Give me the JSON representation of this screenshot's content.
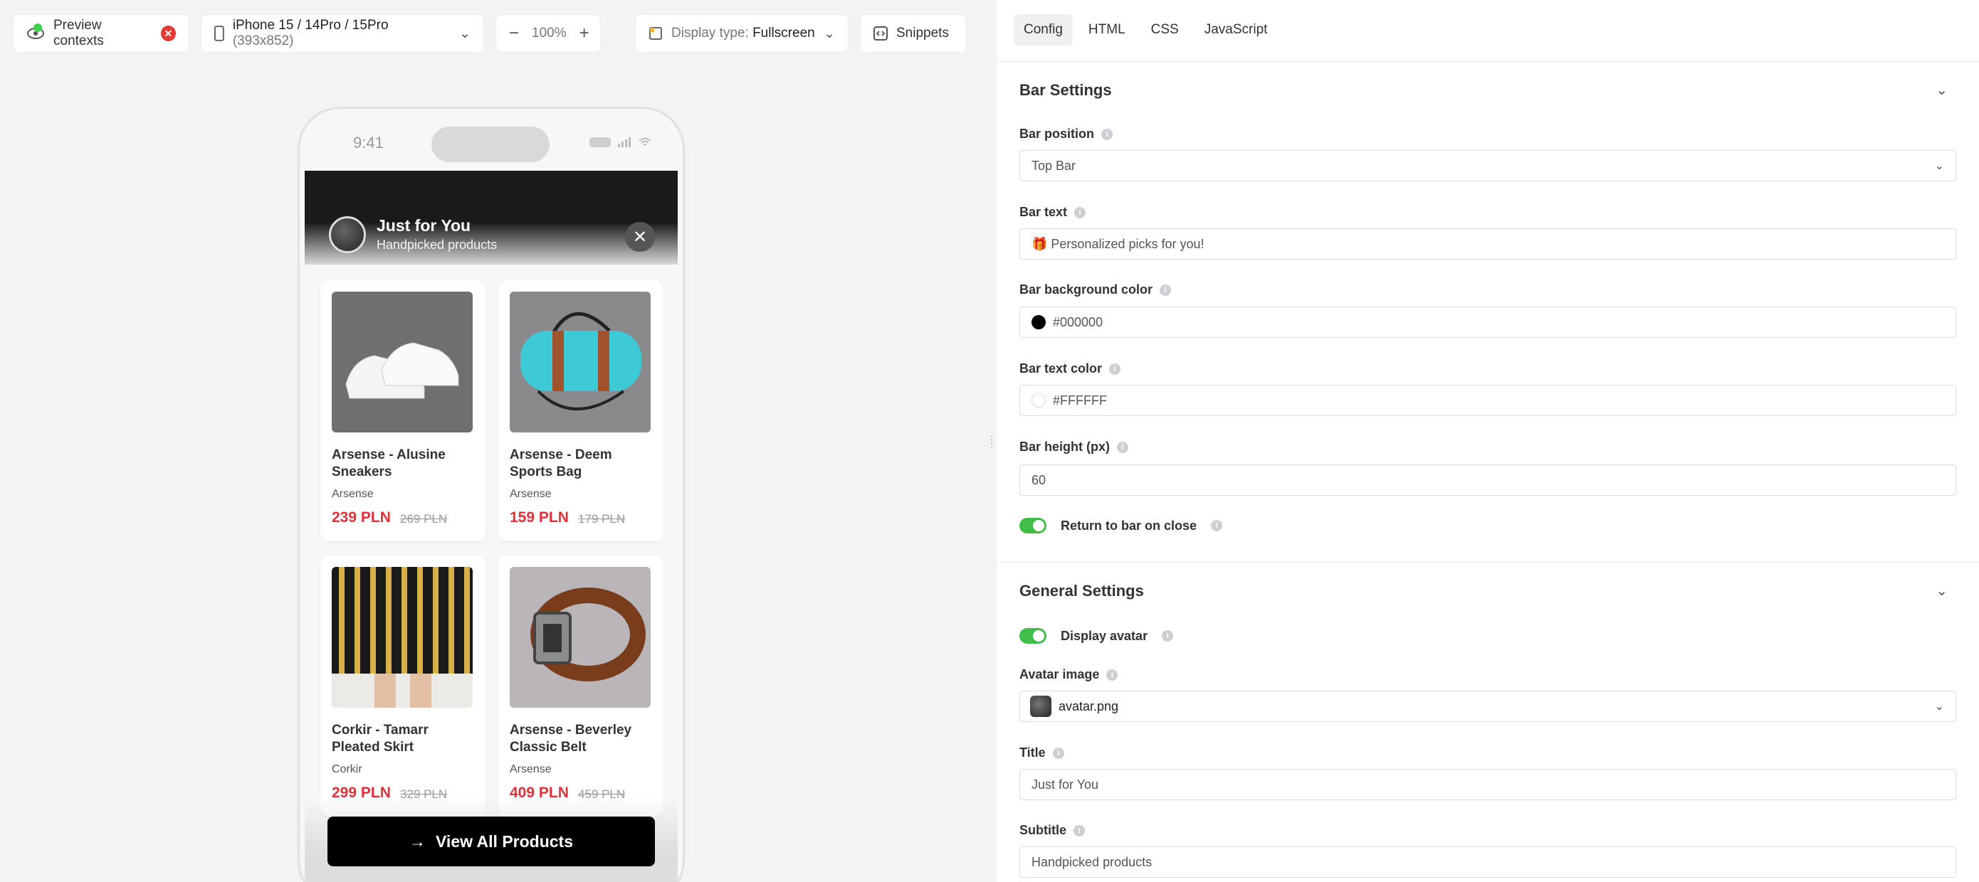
{
  "toolbar": {
    "preview_contexts": "Preview contexts",
    "device": "iPhone 15 / 14Pro / 15Pro",
    "device_size": "(393x852)",
    "zoom": "100%",
    "display_type_label": "Display type:",
    "display_type_value": "Fullscreen",
    "snippets": "Snippets"
  },
  "phone": {
    "time": "9:41",
    "bar_title": "Just for You",
    "bar_subtitle": "Handpicked products",
    "close": "✕",
    "view_all": "View All Products",
    "products": [
      {
        "name": "Arsense - Alusine Sneakers",
        "brand": "Arsense",
        "price": "239 PLN",
        "old_price": "269 PLN",
        "image": "sneakers"
      },
      {
        "name": "Arsense - Deem Sports Bag",
        "brand": "Arsense",
        "price": "159 PLN",
        "old_price": "179 PLN",
        "image": "sports-bag"
      },
      {
        "name": "Corkir - Tamarr Pleated Skirt",
        "brand": "Corkir",
        "price": "299 PLN",
        "old_price": "329 PLN",
        "image": "skirt"
      },
      {
        "name": "Arsense - Beverley Classic Belt",
        "brand": "Arsense",
        "price": "409 PLN",
        "old_price": "459 PLN",
        "image": "belt"
      }
    ]
  },
  "tabs": [
    "Config",
    "HTML",
    "CSS",
    "JavaScript"
  ],
  "bar_settings": {
    "title": "Bar Settings",
    "position_label": "Bar position",
    "position_value": "Top Bar",
    "text_label": "Bar text",
    "text_value": "🎁 Personalized picks for you!",
    "bg_label": "Bar background color",
    "bg_value": "#000000",
    "text_color_label": "Bar text color",
    "text_color_value": "#FFFFFF",
    "height_label": "Bar height (px)",
    "height_value": "60",
    "return_label": "Return to bar on close"
  },
  "general_settings": {
    "title": "General Settings",
    "display_avatar_label": "Display avatar",
    "avatar_label": "Avatar image",
    "avatar_value": "avatar.png",
    "title_label": "Title",
    "title_value": "Just for You",
    "subtitle_label": "Subtitle",
    "subtitle_value": "Handpicked products"
  },
  "colors": {
    "accent_green": "#3fbf4a",
    "price_red": "#e0313a",
    "badge_red": "#e53935"
  }
}
